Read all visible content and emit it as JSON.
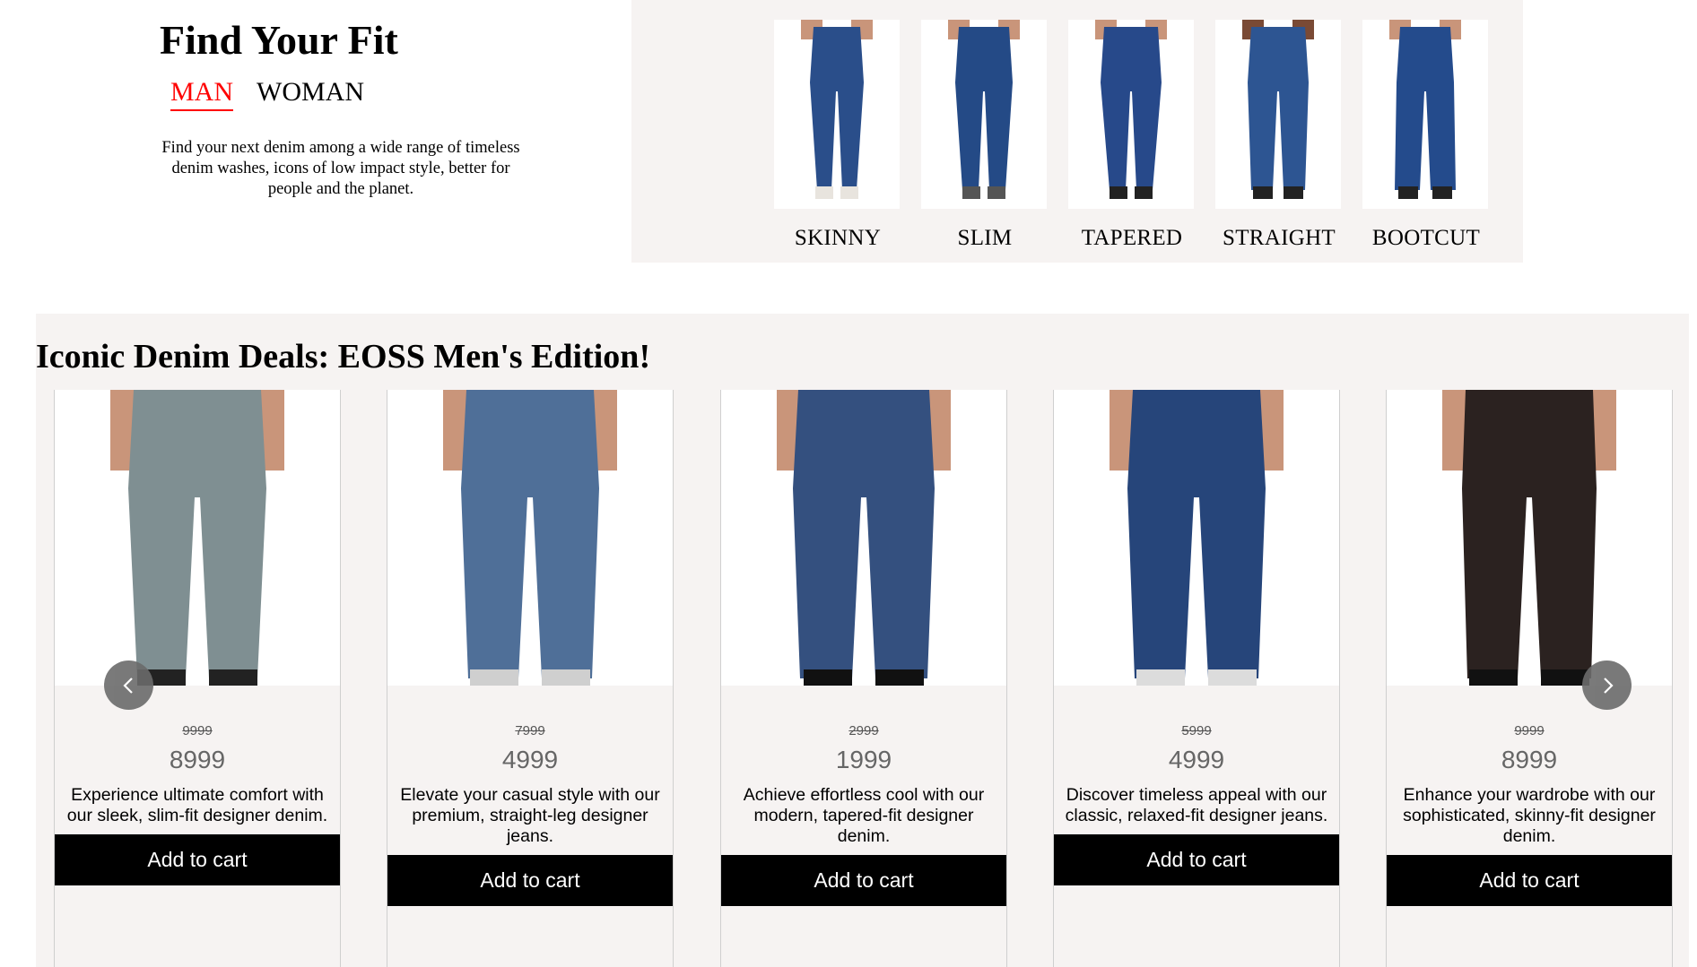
{
  "fit_section": {
    "title": "Find Your Fit",
    "tabs": [
      {
        "label": "MAN",
        "active": true
      },
      {
        "label": "WOMAN",
        "active": false
      }
    ],
    "description": "Find your next denim among a wide range of timeless denim washes, icons of low impact style, better for people and the planet.",
    "fits": [
      {
        "label": "SKINNY"
      },
      {
        "label": "SLIM"
      },
      {
        "label": "TAPERED"
      },
      {
        "label": "STRAIGHT"
      },
      {
        "label": "BOOTCUT"
      }
    ]
  },
  "deals": {
    "title": "Iconic Denim Deals: EOSS Men's Edition!",
    "products": [
      {
        "old_price": "9999",
        "price": "8999",
        "description": "Experience ultimate comfort with our sleek, slim-fit designer denim.",
        "cta": "Add to cart",
        "denim_color": "#7f8f92"
      },
      {
        "old_price": "7999",
        "price": "4999",
        "description": "Elevate your casual style with our premium, straight-leg designer jeans.",
        "cta": "Add to cart",
        "denim_color": "#4f6f98"
      },
      {
        "old_price": "2999",
        "price": "1999",
        "description": "Achieve effortless cool with our modern, tapered-fit designer denim.",
        "cta": "Add to cart",
        "denim_color": "#34507f"
      },
      {
        "old_price": "5999",
        "price": "4999",
        "description": "Discover timeless appeal with our classic, relaxed-fit designer jeans.",
        "cta": "Add to cart",
        "denim_color": "#26457a"
      },
      {
        "old_price": "9999",
        "price": "8999",
        "description": "Enhance your wardrobe with our sophisticated, skinny-fit designer denim.",
        "cta": "Add to cart",
        "denim_color": "#2b2220"
      }
    ]
  },
  "carousel": {
    "prev_icon": "chevron-left-icon",
    "next_icon": "chevron-right-icon"
  },
  "colors": {
    "accent": "#ff0000",
    "panel_bg": "#f6f3f2",
    "button_bg": "#000000",
    "fit_denim": "#2a4e8a"
  }
}
